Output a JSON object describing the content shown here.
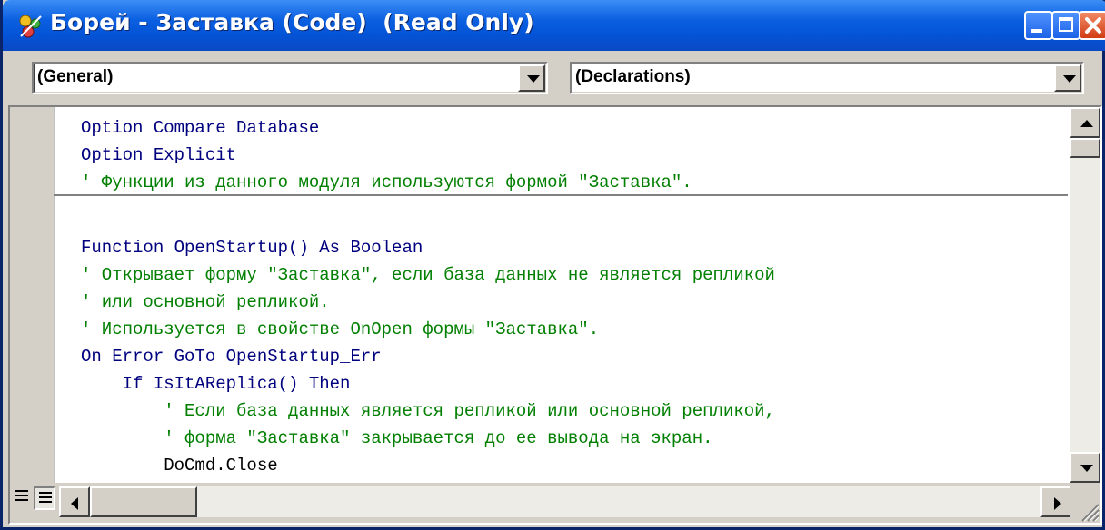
{
  "window": {
    "title": "Борей - Заставка (Code)  (Read Only)",
    "icon": "access-module-icon"
  },
  "toolbar": {
    "object_combo": "(General)",
    "procedure_combo": "(Declarations)"
  },
  "colors": {
    "keyword": "#00007f",
    "comment": "#007f00",
    "text": "#000000",
    "titlebar": "#0453d6"
  },
  "code": {
    "declarations": [
      {
        "kind": "kw",
        "text": "Option Compare Database"
      },
      {
        "kind": "kw",
        "text": "Option Explicit"
      },
      {
        "kind": "cm",
        "text": "' Функции из данного модуля используются формой \"Заставка\"."
      }
    ],
    "procedure": [
      {
        "kind": "kw",
        "text": "Function OpenStartup() As Boolean"
      },
      {
        "kind": "cm",
        "text": "' Открывает форму \"Заставка\", если база данных не является репликой"
      },
      {
        "kind": "cm",
        "text": "' или основной репликой."
      },
      {
        "kind": "cm",
        "text": "' Используется в свойстве OnOpen формы \"Заставка\"."
      },
      {
        "kind": "kw",
        "text": "On Error GoTo OpenStartup_Err"
      },
      {
        "kind": "kw",
        "text": "    If IsItAReplica() Then"
      },
      {
        "kind": "cm",
        "text": "        ' Если база данных является репликой или основной репликой,"
      },
      {
        "kind": "cm",
        "text": "        ' форма \"Заставка\" закрывается до ее вывода на экран."
      },
      {
        "kind": "tx",
        "text": "        DoCmd.Close"
      }
    ]
  }
}
